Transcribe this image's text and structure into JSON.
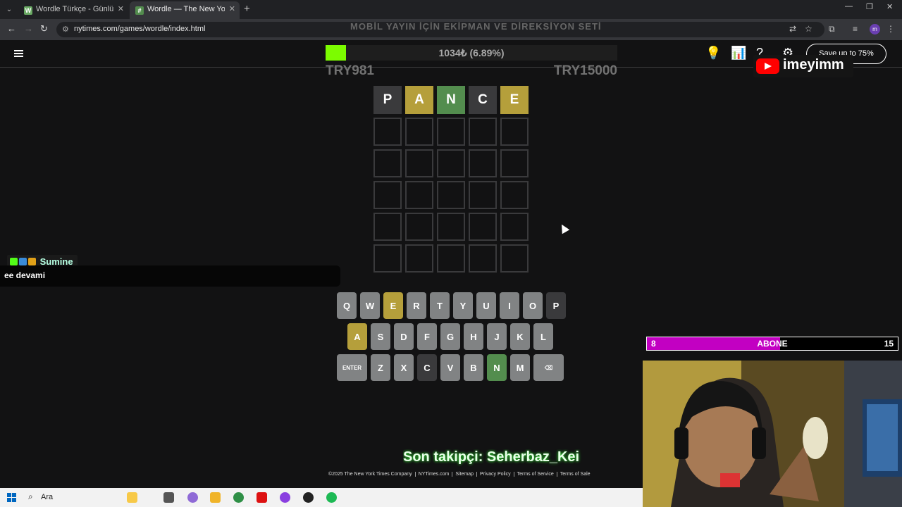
{
  "browser": {
    "tabs": [
      {
        "title": "Wordle Türkçe - Günlük Kelime",
        "favicon_letter": "W",
        "active": false
      },
      {
        "title": "Wordle — The New York Times",
        "favicon_letter": "#",
        "active": true
      }
    ],
    "url": "nytimes.com/games/wordle/index.html",
    "profile_initial": "m"
  },
  "overlay": {
    "banner": "MOBİL YAYIN İÇİN EKİPMAN VE DİREKSİYON SETİ",
    "donation_text": "1034₺ (6.89%)",
    "donation_progress": 0.0689,
    "donation_min": "TRY981",
    "donation_max": "TRY15000",
    "youtube_name": "imeyimm",
    "chat": {
      "user": "Sumine",
      "message": "ee devami"
    },
    "subscribers": {
      "current": "8",
      "label": "ABONE",
      "goal": "15",
      "progress": 0.53
    },
    "follower": "Son takipçi: Seherbaz_Kei"
  },
  "header": {
    "save_label": "Save up to 75%"
  },
  "board": {
    "rows": [
      [
        {
          "letter": "P",
          "state": "absent"
        },
        {
          "letter": "A",
          "state": "present"
        },
        {
          "letter": "N",
          "state": "correct"
        },
        {
          "letter": "C",
          "state": "absent"
        },
        {
          "letter": "E",
          "state": "present"
        }
      ],
      [
        {
          "letter": "",
          "state": "empty"
        },
        {
          "letter": "",
          "state": "empty"
        },
        {
          "letter": "",
          "state": "empty"
        },
        {
          "letter": "",
          "state": "empty"
        },
        {
          "letter": "",
          "state": "empty"
        }
      ],
      [
        {
          "letter": "",
          "state": "empty"
        },
        {
          "letter": "",
          "state": "empty"
        },
        {
          "letter": "",
          "state": "empty"
        },
        {
          "letter": "",
          "state": "empty"
        },
        {
          "letter": "",
          "state": "empty"
        }
      ],
      [
        {
          "letter": "",
          "state": "empty"
        },
        {
          "letter": "",
          "state": "empty"
        },
        {
          "letter": "",
          "state": "empty"
        },
        {
          "letter": "",
          "state": "empty"
        },
        {
          "letter": "",
          "state": "empty"
        }
      ],
      [
        {
          "letter": "",
          "state": "empty"
        },
        {
          "letter": "",
          "state": "empty"
        },
        {
          "letter": "",
          "state": "empty"
        },
        {
          "letter": "",
          "state": "empty"
        },
        {
          "letter": "",
          "state": "empty"
        }
      ],
      [
        {
          "letter": "",
          "state": "empty"
        },
        {
          "letter": "",
          "state": "empty"
        },
        {
          "letter": "",
          "state": "empty"
        },
        {
          "letter": "",
          "state": "empty"
        },
        {
          "letter": "",
          "state": "empty"
        }
      ]
    ]
  },
  "keyboard": {
    "rows": [
      [
        {
          "k": "Q",
          "s": ""
        },
        {
          "k": "W",
          "s": ""
        },
        {
          "k": "E",
          "s": "present"
        },
        {
          "k": "R",
          "s": ""
        },
        {
          "k": "T",
          "s": ""
        },
        {
          "k": "Y",
          "s": ""
        },
        {
          "k": "U",
          "s": ""
        },
        {
          "k": "I",
          "s": ""
        },
        {
          "k": "O",
          "s": ""
        },
        {
          "k": "P",
          "s": "absent"
        }
      ],
      [
        {
          "k": "A",
          "s": "present"
        },
        {
          "k": "S",
          "s": ""
        },
        {
          "k": "D",
          "s": ""
        },
        {
          "k": "F",
          "s": ""
        },
        {
          "k": "G",
          "s": ""
        },
        {
          "k": "H",
          "s": ""
        },
        {
          "k": "J",
          "s": ""
        },
        {
          "k": "K",
          "s": ""
        },
        {
          "k": "L",
          "s": ""
        }
      ],
      [
        {
          "k": "ENTER",
          "s": "",
          "wide": true
        },
        {
          "k": "Z",
          "s": ""
        },
        {
          "k": "X",
          "s": ""
        },
        {
          "k": "C",
          "s": "absent"
        },
        {
          "k": "V",
          "s": ""
        },
        {
          "k": "B",
          "s": ""
        },
        {
          "k": "N",
          "s": "correct"
        },
        {
          "k": "M",
          "s": ""
        },
        {
          "k": "⌫",
          "s": "",
          "wide": true
        }
      ]
    ]
  },
  "footer": [
    "©2025 The New York Times Company",
    "NYTimes.com",
    "Sitemap",
    "Privacy Policy",
    "Terms of Service",
    "Terms of Sale"
  ],
  "taskbar": {
    "search_label": "Ara"
  },
  "colors": {
    "correct": "#538d4e",
    "present": "#b59f3b",
    "absent": "#3a3a3c",
    "key": "#818384",
    "donation": "#7cfc00",
    "subscriber": "#c200c2"
  }
}
